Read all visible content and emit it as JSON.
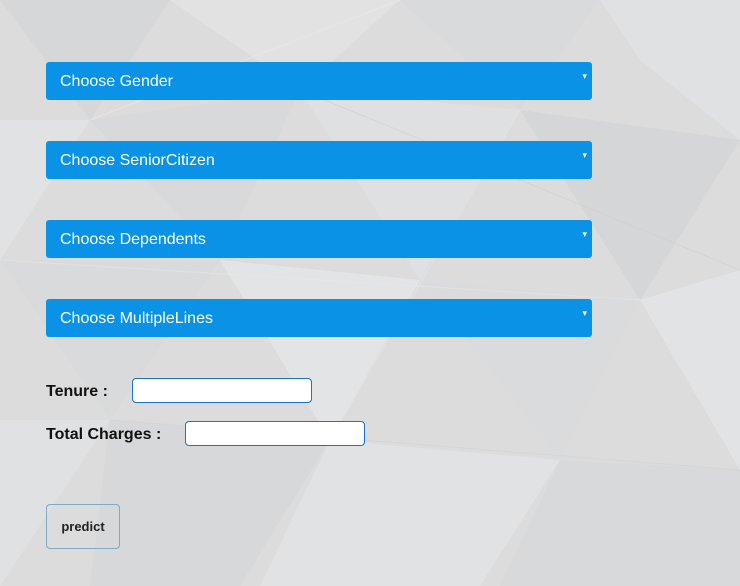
{
  "form": {
    "selects": [
      {
        "label": "Choose Gender"
      },
      {
        "label": "Choose SeniorCitizen"
      },
      {
        "label": "Choose Dependents"
      },
      {
        "label": "Choose MultipleLines"
      }
    ],
    "fields": {
      "tenure": {
        "label": "Tenure :",
        "value": "",
        "placeholder": ""
      },
      "total_charges": {
        "label": "Total Charges :",
        "value": "",
        "placeholder": ""
      }
    },
    "submit_label": "predict"
  },
  "colors": {
    "page_background": "#dcdcdd",
    "select_background": "#0a93e6",
    "select_text": "#ffffff",
    "input_border": "#1a73c9",
    "button_border": "#7fa9c4"
  },
  "icons": {
    "select_chevron": "chevron-down-icon",
    "select_chevron_glyph": "▾"
  }
}
